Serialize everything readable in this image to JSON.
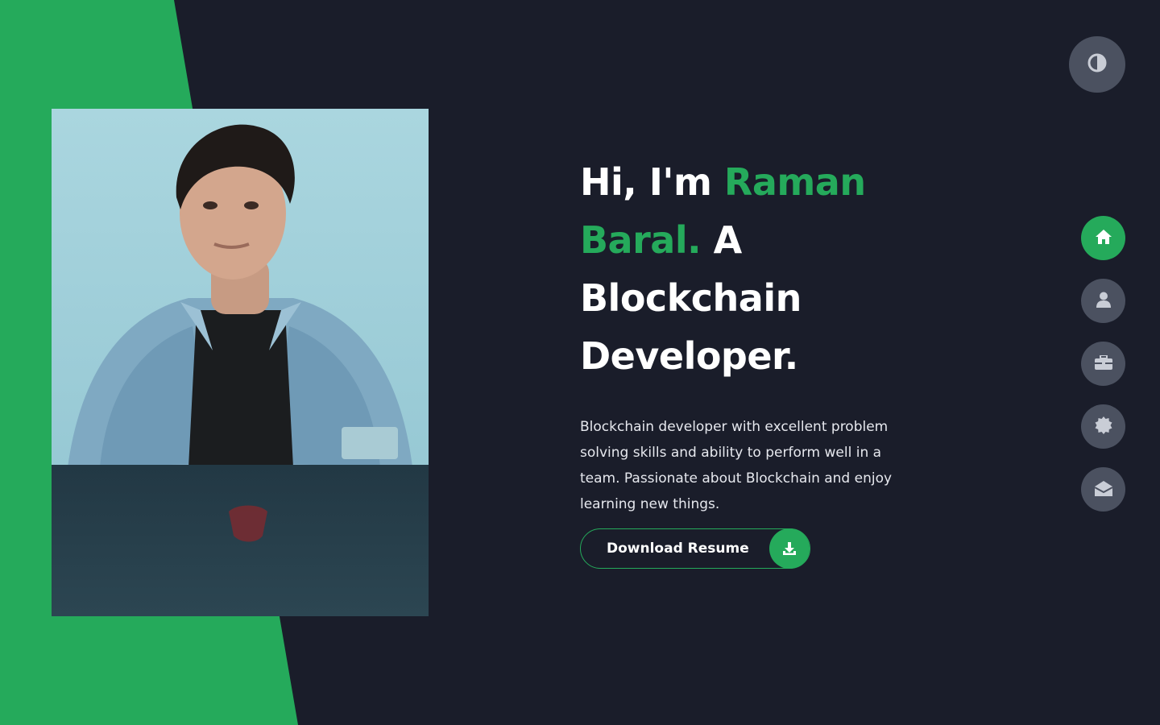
{
  "hero": {
    "greeting": "Hi, I'm",
    "name_line1": "Raman",
    "name_line2": "Baral.",
    "role_prefix": "A",
    "role_line1": "Blockchain",
    "role_line2": "Developer.",
    "bio": "Blockchain developer with excellent problem solving skills and ability to perform well in a team. Passionate about Blockchain and enjoy learning new things.",
    "resume_button": {
      "label": "Download Resume",
      "icon": "download-icon"
    }
  },
  "profile_photo": {
    "alt": "Raman Baral"
  },
  "theme_toggle": {
    "icon": "contrast-icon"
  },
  "side_nav": {
    "items": [
      {
        "name": "home",
        "icon": "home-icon",
        "active": true
      },
      {
        "name": "about",
        "icon": "user-icon",
        "active": false
      },
      {
        "name": "portfolio",
        "icon": "briefcase-icon",
        "active": false
      },
      {
        "name": "skills",
        "icon": "badge-icon",
        "active": false
      },
      {
        "name": "contact",
        "icon": "envelope-open-icon",
        "active": false
      }
    ]
  },
  "colors": {
    "accent": "#25aa5b",
    "background": "#1a1d2a",
    "button_gray": "#4b5160",
    "text": "#ffffff"
  }
}
